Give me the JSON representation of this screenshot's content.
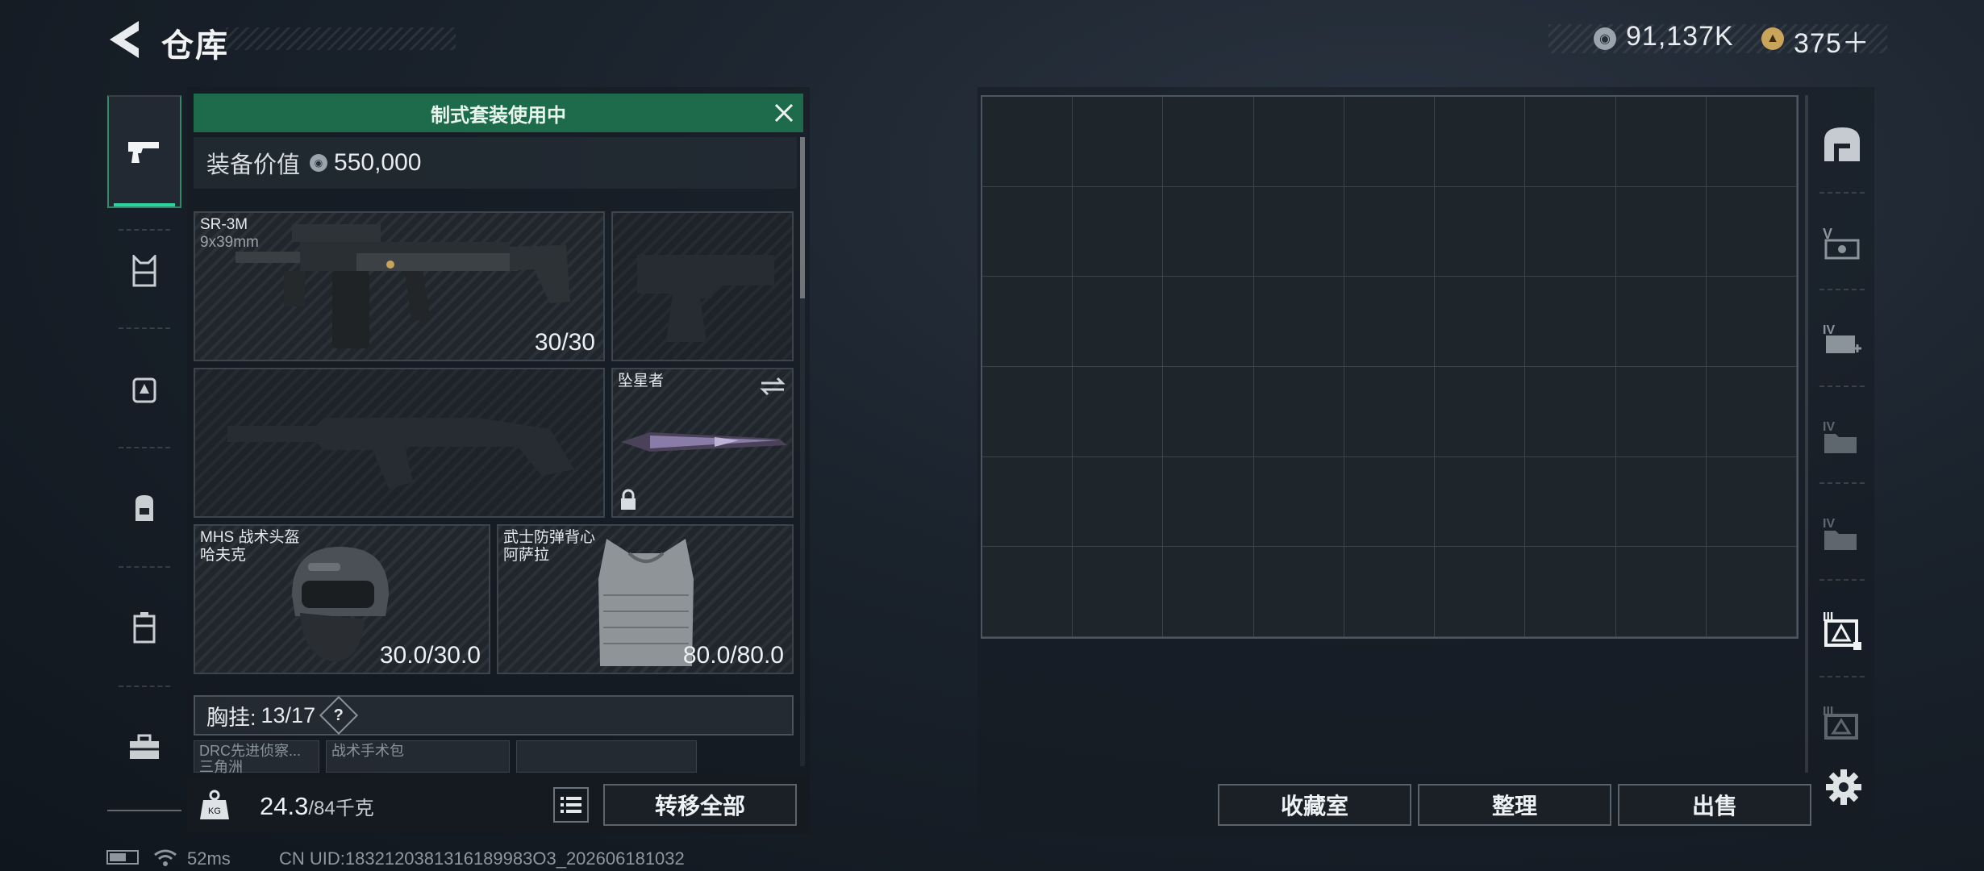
{
  "header": {
    "title": "仓库",
    "back_icon": "back-arrow-icon"
  },
  "currency": {
    "silver": "91,137K",
    "gold": "375＋"
  },
  "nav": {
    "items": [
      {
        "name": "weapon",
        "icon": "pistol-icon",
        "active": true
      },
      {
        "name": "armor",
        "icon": "vest-icon"
      },
      {
        "name": "rig",
        "icon": "chest-rig-icon"
      },
      {
        "name": "backpack",
        "icon": "backpack-icon"
      },
      {
        "name": "container",
        "icon": "case-icon"
      },
      {
        "name": "toolbox",
        "icon": "toolbox-icon"
      }
    ]
  },
  "loadout": {
    "banner": "制式套装使用中",
    "value_label": "装备价值",
    "value": "550,000",
    "primary": {
      "name": "SR-3M",
      "caliber": "9x39mm",
      "ammo": "30/30"
    },
    "melee": {
      "name": "坠星者"
    },
    "helmet": {
      "name": "MHS 战术头盔",
      "sub": "哈夫克",
      "durability": "30.0/30.0"
    },
    "vest": {
      "name": "武士防弹背心",
      "sub": "阿萨拉",
      "durability": "80.0/80.0"
    },
    "rig": {
      "label": "胸挂:",
      "count": "13/17",
      "help": "?"
    },
    "rig_items": [
      "DRC先进侦察...",
      "战术手术包"
    ],
    "rig_item_sub": "三角洲",
    "weight": "24.3",
    "weight_max": "/84千克",
    "transfer_all": "转移全部"
  },
  "stash": {
    "buttons": {
      "collection": "收藏室",
      "sort": "整理",
      "sell": "出售"
    }
  },
  "status": {
    "ping": "52ms",
    "uid": "CN UID:1832120381316189983O3_202606181032"
  },
  "colors": {
    "accent": "#2bd39a",
    "banner": "#1e6b4c"
  }
}
